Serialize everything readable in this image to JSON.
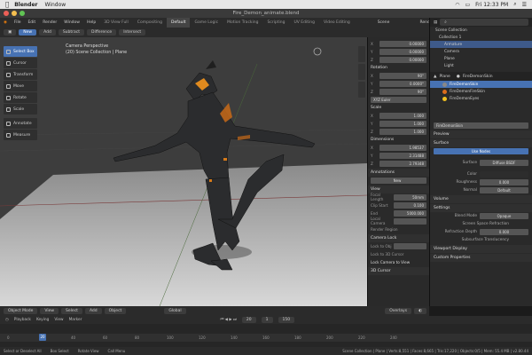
{
  "mac": {
    "app": "Blender",
    "menu": "Window",
    "clock": "Fri 12:33 PM"
  },
  "window_title": "Fire_Demon_animate.blend",
  "menubar": {
    "items": [
      "File",
      "Edit",
      "Render",
      "Window",
      "Help"
    ],
    "workspaces": [
      "3D View Full",
      "Compositing",
      "Default",
      "Game Logic",
      "Motion Tracking",
      "Scripting",
      "UV Editing",
      "Video Editing"
    ],
    "active_workspace": "Default",
    "scene": "Scene",
    "render_layer": "RenderLayer"
  },
  "toolheader": {
    "new": "New",
    "add": "Add",
    "subtract": "Subtract",
    "difference": "Difference",
    "intersect": "Intersect"
  },
  "toolbar": [
    "Select Box",
    "Cursor",
    "Transform",
    "Move",
    "Rotate",
    "Scale",
    "Annotate",
    "Measure"
  ],
  "viewport": {
    "line1": "Camera Perspective",
    "line2": "(20) Scene Collection | Plane"
  },
  "npanel": {
    "location": [
      "0.00000",
      "0.00000",
      "0.00000"
    ],
    "rotation_label": "Rotation",
    "rotation": [
      "90°",
      "0.0000°",
      "90°"
    ],
    "mode": "XYZ Euler",
    "scale_label": "Scale",
    "scale": [
      "1.000",
      "1.000",
      "1.000"
    ],
    "dimensions_label": "Dimensions",
    "dimensions": [
      "1.98537",
      "2.31488",
      "2.79348"
    ],
    "annotations_label": "Annotations",
    "new_label": "New",
    "view_label": "View",
    "focal_label": "Focal Length",
    "focal": "50mm",
    "clip_start_label": "Clip Start",
    "clip_start": "0.100",
    "end_label": "End",
    "end": "5000.000",
    "local_camera_label": "Local Camera",
    "render_region": "Render Region",
    "camera_lock": "Camera Lock",
    "lock_to_object": "Lock to Obj",
    "lock_to_cursor": "Lock to 3D Cursor",
    "lock_camera_to_view": "Lock Camera to View",
    "cursor_label": "3D Cursor"
  },
  "outliner": {
    "header": "Scene Collection",
    "rows": [
      "Collection 1",
      "Armature",
      "Camera",
      "Plane",
      "Light"
    ]
  },
  "props": {
    "object": "Plane",
    "material": "FireDemonSkin",
    "materials": [
      "FireDemonSkin",
      "FireDemonFireSkin",
      "FireDemonEyes"
    ],
    "slot_name": "FireDemonSkin",
    "preview": "Preview",
    "surface": "Surface",
    "use_nodes": "Use Nodes",
    "surface_label": "Surface",
    "surface_val": "Diffuse BSDF",
    "color_label": "Color",
    "roughness_label": "Roughness",
    "roughness": "0.000",
    "normal_label": "Normal",
    "normal": "Default",
    "volume": "Volume",
    "settings": "Settings",
    "blend_label": "Blend Mode",
    "blend": "Opaque",
    "ssr_label": "Screen Space Refraction",
    "depth_label": "Refraction Depth",
    "depth": "0.000",
    "sst_label": "Subsurface Translucency",
    "viewport_display": "Viewport Display",
    "custom_props": "Custom Properties"
  },
  "vpbottom": {
    "mode": "Object Mode",
    "view": "View",
    "select": "Select",
    "add": "Add",
    "object": "Object",
    "global": "Global",
    "overlays": "Overlays"
  },
  "timeline": {
    "playback": "Playback",
    "keying": "Keying",
    "view": "View",
    "marker": "Marker",
    "frame": "20",
    "start": "1",
    "end": "150",
    "ticks": [
      "0",
      "20",
      "40",
      "60",
      "80",
      "100",
      "120",
      "140",
      "160",
      "180",
      "200",
      "220",
      "240"
    ]
  },
  "status": {
    "select": "Select or Deselect All",
    "box": "Box Select",
    "rotate": "Rotate View",
    "menu": "Call Menu",
    "stats": "Scene Collection | Plane | Verts:8,551 | Faces:8,665 | Tris:17,220 | Objects:0/5 | Mem: 55.4 MB | v2.80.44"
  },
  "colors": {
    "accent": "#4772b3",
    "fire": "#e08a1e"
  }
}
